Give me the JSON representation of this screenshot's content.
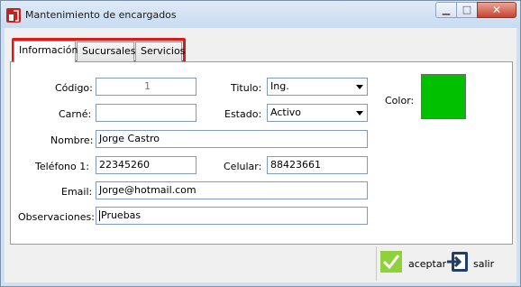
{
  "window": {
    "title": "Mantenimiento de encargados",
    "min_glyph": "▁",
    "max_glyph": "□",
    "close_glyph": "✕"
  },
  "tabs": [
    {
      "label": "Información",
      "active": true
    },
    {
      "label": "Sucursales",
      "active": false
    },
    {
      "label": "Servicios",
      "active": false
    }
  ],
  "form": {
    "codigo_label": "Código:",
    "codigo_value": "1",
    "carne_label": "Carné:",
    "carne_value": "",
    "nombre_label": "Nombre:",
    "nombre_value": "Jorge Castro",
    "telefono_label": "Teléfono 1:",
    "telefono_value": "22345260",
    "email_label": "Email:",
    "email_value": "Jorge@hotmail.com",
    "observaciones_label": "Observaciones:",
    "observaciones_value": "Pruebas",
    "titulo_label": "Titulo:",
    "titulo_value": "Ing.",
    "estado_label": "Estado:",
    "estado_value": "Activo",
    "celular_label": "Celular:",
    "celular_value": "88423661",
    "color_label": "Color:",
    "color_value": "#00c000"
  },
  "actions": {
    "aceptar_label": "aceptar",
    "salir_label": "salir"
  },
  "colors": {
    "highlight": "#e01818",
    "accept_icon": "#8ed13a",
    "exit_icon": "#1f3f66"
  }
}
